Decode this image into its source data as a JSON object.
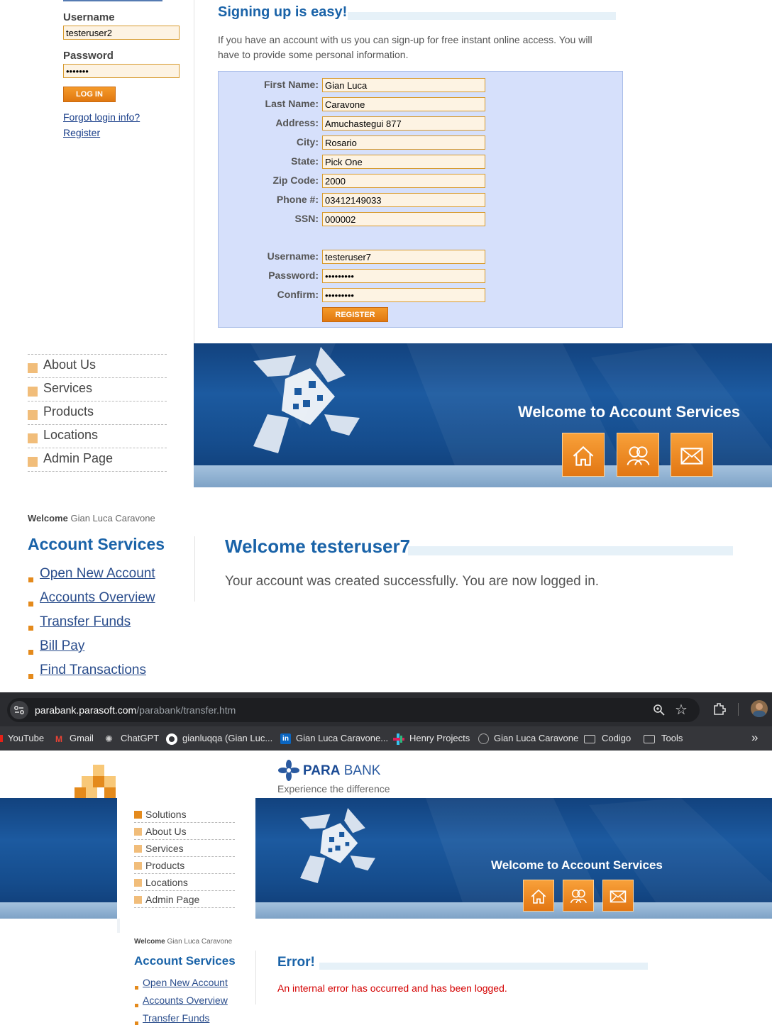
{
  "login": {
    "username_label": "Username",
    "username_value": "testeruser2",
    "password_label": "Password",
    "password_value": "•••••••",
    "login_button": "LOG IN",
    "forgot_link": "Forgot login info?",
    "register_link": "Register"
  },
  "signup": {
    "title": "Signing up is easy!",
    "intro": "If you have an account with us you can sign-up for free instant online access. You will have to provide some personal information.",
    "fields": [
      {
        "label": "First Name:",
        "value": "Gian Luca"
      },
      {
        "label": "Last Name:",
        "value": "Caravone"
      },
      {
        "label": "Address:",
        "value": "Amuchastegui 877"
      },
      {
        "label": "City:",
        "value": "Rosario"
      },
      {
        "label": "State:",
        "value": "Pick One"
      },
      {
        "label": "Zip Code:",
        "value": "2000"
      },
      {
        "label": "Phone #:",
        "value": "03412149033"
      },
      {
        "label": "SSN:",
        "value": "000002"
      }
    ],
    "credentials": [
      {
        "label": "Username:",
        "value": "testeruser7"
      },
      {
        "label": "Password:",
        "value": "•••••••••"
      },
      {
        "label": "Confirm:",
        "value": "•••••••••"
      }
    ],
    "register_button": "REGISTER"
  },
  "nav_menu": [
    "Solutions",
    "About Us",
    "Services",
    "Products",
    "Locations",
    "Admin Page"
  ],
  "banner": {
    "welcome": "Welcome to Account Services"
  },
  "account_panel": {
    "welcome_prefix": "Welcome",
    "welcome_name": "Gian Luca Caravone",
    "title": "Account Services",
    "links": [
      "Open New Account",
      "Accounts Overview",
      "Transfer Funds",
      "Bill Pay",
      "Find Transactions"
    ]
  },
  "welcome_main": {
    "title": "Welcome testeruser7",
    "message": "Your account was created successfully. You are now logged in."
  },
  "browser": {
    "url_domain": "parabank.parasoft.com",
    "url_path": "/parabank/transfer.htm",
    "bookmarks": [
      "YouTube",
      "Gmail",
      "ChatGPT",
      "gianluqqa (Gian Luc...",
      "Gian Luca Caravone...",
      "Henry Projects",
      "Gian Luca Caravone",
      "Codigo",
      "Tools"
    ]
  },
  "brand": {
    "name_bold": "PARA",
    "name_light": "BANK",
    "tagline": "Experience the difference"
  },
  "error_main": {
    "title": "Error!",
    "message": "An internal error has occurred and has been logged."
  },
  "colors": {
    "accent_orange": "#e48a1c",
    "title_blue": "#1a63a8",
    "error_red": "#d40000"
  }
}
